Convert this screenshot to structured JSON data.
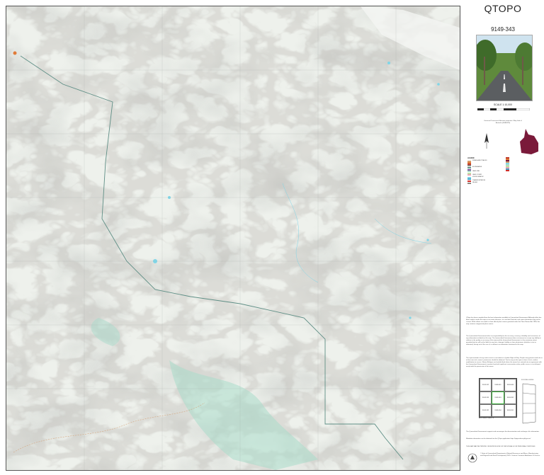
{
  "map": {
    "title": "QTOPO",
    "sheet_number": "9149-343",
    "scale": "SCALE 1:10,000",
    "colors": {
      "background": "#eef1ec",
      "relief_shade": "#c9cdc8",
      "contour": "#8e8a84",
      "boundary": "#5f8f86",
      "water": "#7fd6e8",
      "vegetation": "#a9dccb",
      "road": "#d59a6a"
    }
  },
  "sidebar": {
    "projection_note": "Universal Transverse Mercator projection / Map Grid of Australia (GDA2020)",
    "legend_header": "LEGEND",
    "legend_sections": [
      "ROADS AND TRACKS",
      "BOUNDARIES",
      "LAND USE",
      "LAND COVER",
      "HYDROGRAPHY",
      "TRANSPORTATION",
      "RELIEF"
    ],
    "disclaimer_1": "QTopo has been compiled from the best information available to Queensland Government. Although effort has been made to make the map as accurate reference, it is not field checked, and some information may not be current. While efforts are made to show official place names gazetted under the Place Names Act 1994, this map contains unapproved place names.",
    "disclaimer_2": "The Queensland Government takes no responsibility for the accuracy, currency, reliability and correctness of any information included on this map. The Queensland Government does not warrant or accept any liability in relation to the quality or accuracy of this map and the Queensland Government, to the maximum extent permitted by law, will not be liable for any loss, damage, liability or claim whatsoever (whether in tort or otherwise) arising out of the use of, or reliance on information contained in this map.",
    "disclaimer_3": "The representation of any road or track is not evidence of public Right of Way. People using private roads do so at their own risk, owners' permission should be obtained. Tracks may not be open at time of visit, confirm modification to access. Nature Refuges are freehold land where the owner has entered into an agreement with the Queensland Government to protect land with significant conservation value; public access is not allowed, except with the permission of the owner.",
    "support_text": "The Queensland Government supports and encourages the dissemination and exchange of its information.",
    "metadata_text": "Metadata information can be obtained via the QTopo application https://qtopo.dnrm.qld.gov.au/",
    "not_for_sale": "THIS MAP MAY BE PRINTED OR REPRODUCED BY INDIVIDUALS FOR PERSONAL PURPOSES",
    "index_label": "ADJOINING SHEETS",
    "folding_label": "FOLDING GUIDE",
    "adjoining": [
      "9149-312",
      "9149-341",
      "9149-344",
      "9149-313",
      "9149-343",
      "9149-332",
      "9149-322",
      "9149-334",
      "9149-331"
    ],
    "credits": "© State of Queensland (Department of Natural Resources and Mines, Manufacturing and Regional and Rural Development) 2025. Creative Commons Attribution 4.0 licence."
  }
}
